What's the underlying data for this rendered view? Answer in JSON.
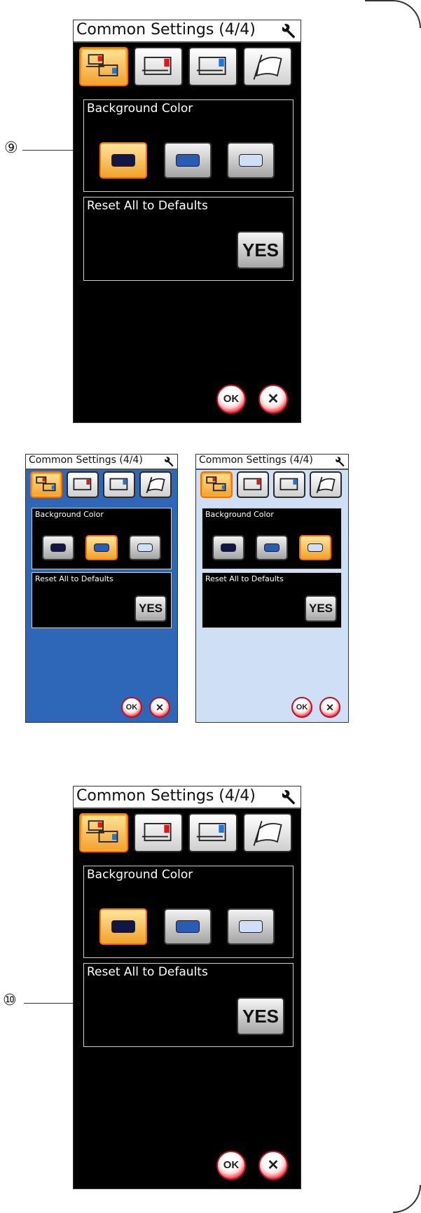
{
  "screen": {
    "title": "Common Settings (4/4)",
    "background_color_label": "Background Color",
    "reset_label": "Reset All to Defaults",
    "yes_label": "YES",
    "ok_label": "OK",
    "cancel_label": "✕",
    "tool_icon": "wrench-icon",
    "tabs": [
      "common-settings-tab",
      "sewing-settings-tab",
      "embroidery-settings-tab",
      "language-tab"
    ]
  },
  "swatches": {
    "dark": "#131545",
    "blue": "#2a5cb3",
    "light": "#cfdff7"
  },
  "screens": [
    {
      "background": "#000000",
      "selected_swatch": "dark"
    },
    {
      "background": "#2e66b8",
      "selected_swatch": "blue"
    },
    {
      "background": "#cfe0f6",
      "selected_swatch": "light"
    },
    {
      "background": "#000000",
      "selected_swatch": "dark"
    }
  ],
  "callouts": {
    "c9": "⑨",
    "c10": "⑩"
  }
}
